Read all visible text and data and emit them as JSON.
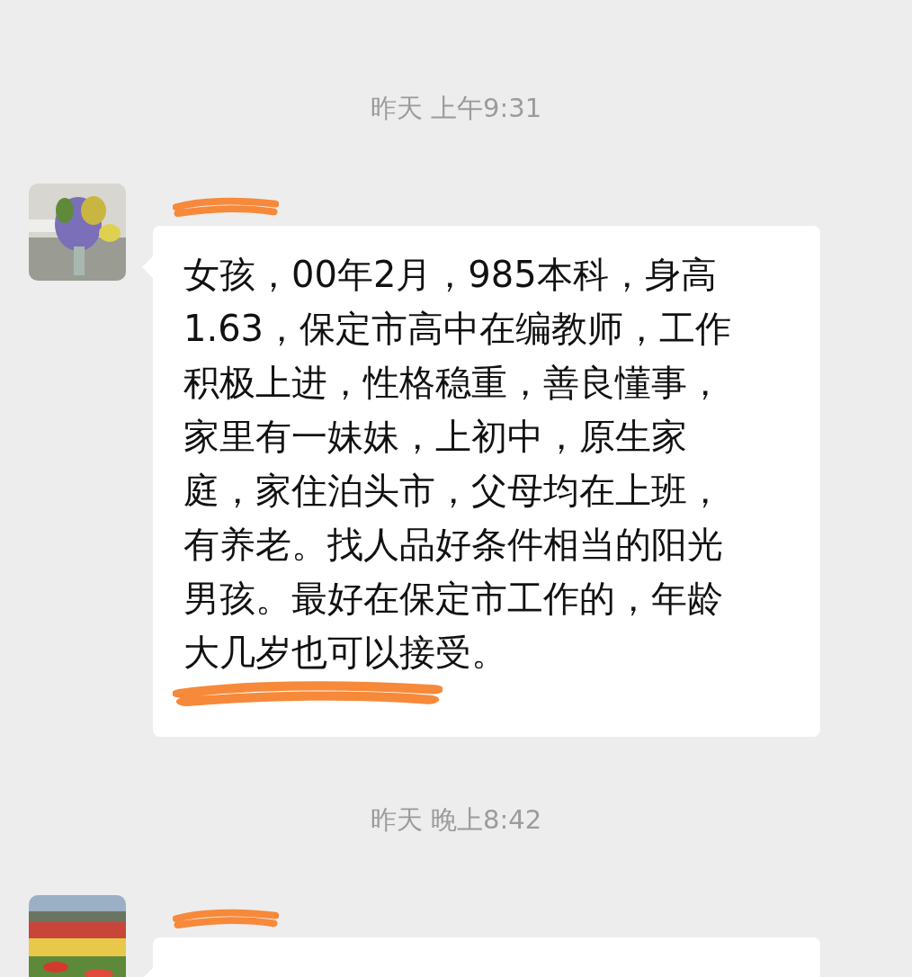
{
  "messages": [
    {
      "kind": "time",
      "text": "昨天 上午9:31"
    },
    {
      "kind": "incoming",
      "name_redacted": true,
      "lines": [
        "女孩，00年2月，985本科，身高",
        "1.63，保定市高中在编教师，工作",
        "积极上进，性格稳重，善良懂事，",
        "家里有一妹妹，上初中，原生家",
        "庭，家住泊头市，父母均在上班，",
        "有养老。找人品好条件相当的阳光",
        "男孩。最好在保定市工作的，年龄",
        "大几岁也可以接受。"
      ],
      "redacted_line": true
    },
    {
      "kind": "time",
      "text": "昨天 晚上8:42"
    },
    {
      "kind": "incoming",
      "name_redacted": true,
      "redacted_line": false
    }
  ]
}
